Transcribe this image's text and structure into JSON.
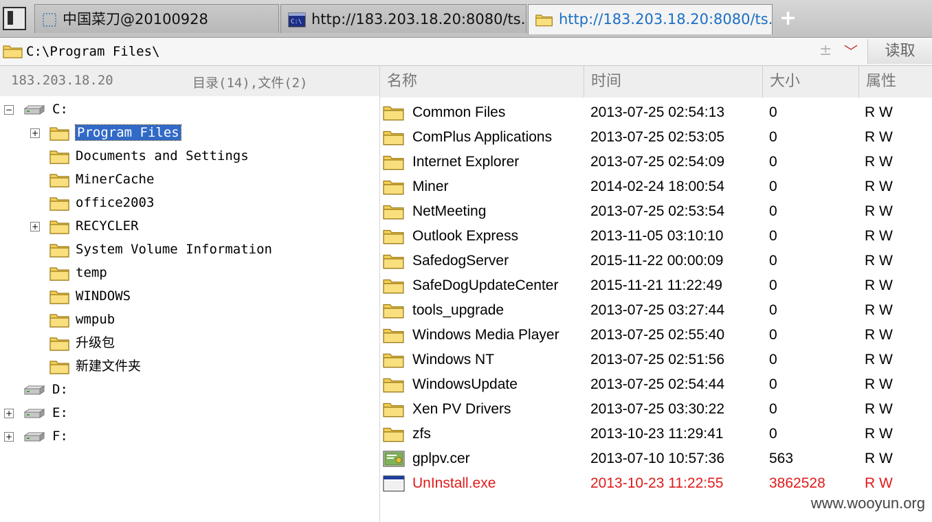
{
  "tabs": [
    {
      "label": "中国菜刀@20100928",
      "active": false,
      "icon": "blank-page-icon"
    },
    {
      "label": "http://183.203.18.20:8080/ts...",
      "active": false,
      "icon": "terminal-icon"
    },
    {
      "label": "http://183.203.18.20:8080/ts...",
      "active": true,
      "icon": "folder-icon"
    }
  ],
  "new_tab_label": "+",
  "address": {
    "path": "C:\\Program Files\\",
    "pm": "±",
    "chev": "﹀",
    "read_button": "读取"
  },
  "left_header": {
    "host": "183.203.18.20",
    "summary": "目录(14),文件(2)"
  },
  "tree": [
    {
      "label": "C:",
      "type": "drive",
      "expander": "−",
      "level": 0
    },
    {
      "label": "Program Files",
      "type": "folder",
      "expander": "+",
      "level": 1,
      "selected": true
    },
    {
      "label": "Documents and Settings",
      "type": "folder",
      "expander": "",
      "level": 1
    },
    {
      "label": "MinerCache",
      "type": "folder",
      "expander": "",
      "level": 1
    },
    {
      "label": "office2003",
      "type": "folder",
      "expander": "",
      "level": 1
    },
    {
      "label": "RECYCLER",
      "type": "folder",
      "expander": "+",
      "level": 1
    },
    {
      "label": "System Volume Information",
      "type": "folder",
      "expander": "",
      "level": 1
    },
    {
      "label": "temp",
      "type": "folder",
      "expander": "",
      "level": 1
    },
    {
      "label": "WINDOWS",
      "type": "folder",
      "expander": "",
      "level": 1
    },
    {
      "label": "wmpub",
      "type": "folder",
      "expander": "",
      "level": 1
    },
    {
      "label": "升级包",
      "type": "folder",
      "expander": "",
      "level": 1
    },
    {
      "label": "新建文件夹",
      "type": "folder",
      "expander": "",
      "level": 1
    },
    {
      "label": "D:",
      "type": "drive",
      "expander": "",
      "level": 0
    },
    {
      "label": "E:",
      "type": "drive",
      "expander": "+",
      "level": 0
    },
    {
      "label": "F:",
      "type": "drive",
      "expander": "+",
      "level": 0
    }
  ],
  "columns": {
    "name": "名称",
    "time": "时间",
    "size": "大小",
    "attr": "属性"
  },
  "files": [
    {
      "name": "Common Files",
      "time": "2013-07-25 02:54:13",
      "size": "0",
      "attr": "R W",
      "icon": "folder-icon"
    },
    {
      "name": "ComPlus Applications",
      "time": "2013-07-25 02:53:05",
      "size": "0",
      "attr": "R W",
      "icon": "folder-icon"
    },
    {
      "name": "Internet Explorer",
      "time": "2013-07-25 02:54:09",
      "size": "0",
      "attr": "R W",
      "icon": "folder-icon"
    },
    {
      "name": "Miner",
      "time": "2014-02-24 18:00:54",
      "size": "0",
      "attr": "R W",
      "icon": "folder-icon"
    },
    {
      "name": "NetMeeting",
      "time": "2013-07-25 02:53:54",
      "size": "0",
      "attr": "R W",
      "icon": "folder-icon"
    },
    {
      "name": "Outlook Express",
      "time": "2013-11-05 03:10:10",
      "size": "0",
      "attr": "R W",
      "icon": "folder-icon"
    },
    {
      "name": "SafedogServer",
      "time": "2015-11-22 00:00:09",
      "size": "0",
      "attr": "R W",
      "icon": "folder-icon"
    },
    {
      "name": "SafeDogUpdateCenter",
      "time": "2015-11-21 11:22:49",
      "size": "0",
      "attr": "R W",
      "icon": "folder-icon"
    },
    {
      "name": "tools_upgrade",
      "time": "2013-07-25 03:27:44",
      "size": "0",
      "attr": "R W",
      "icon": "folder-icon"
    },
    {
      "name": "Windows Media Player",
      "time": "2013-07-25 02:55:40",
      "size": "0",
      "attr": "R W",
      "icon": "folder-icon"
    },
    {
      "name": "Windows NT",
      "time": "2013-07-25 02:51:56",
      "size": "0",
      "attr": "R W",
      "icon": "folder-icon"
    },
    {
      "name": "WindowsUpdate",
      "time": "2013-07-25 02:54:44",
      "size": "0",
      "attr": "R W",
      "icon": "folder-icon"
    },
    {
      "name": "Xen PV Drivers",
      "time": "2013-07-25 03:30:22",
      "size": "0",
      "attr": "R W",
      "icon": "folder-icon"
    },
    {
      "name": "zfs",
      "time": "2013-10-23 11:29:41",
      "size": "0",
      "attr": "R W",
      "icon": "folder-icon"
    },
    {
      "name": "gplpv.cer",
      "time": "2013-07-10 10:57:36",
      "size": "563",
      "attr": "R W",
      "icon": "certificate-icon"
    },
    {
      "name": "UnInstall.exe",
      "time": "2013-10-23 11:22:55",
      "size": "3862528",
      "attr": "R W",
      "icon": "executable-icon",
      "highlight": "#e01a1a"
    }
  ],
  "watermark": "www.wooyun.org"
}
